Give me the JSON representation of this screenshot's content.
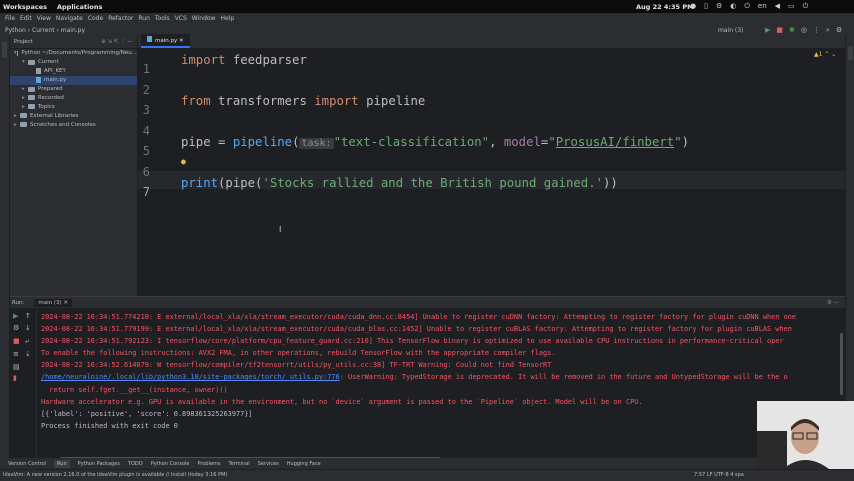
{
  "topbar": {
    "workspaces": "Workspaces",
    "applications": "Applications",
    "clock": "Aug 22  4:35 PM",
    "lang": "en"
  },
  "menu": [
    "File",
    "Edit",
    "View",
    "Navigate",
    "Code",
    "Refactor",
    "Run",
    "Tools",
    "VCS",
    "Window",
    "Help"
  ],
  "nav": {
    "breadcrumb": "Python › Current › main.py",
    "branch": "main (3)"
  },
  "project": {
    "title": "Project",
    "tree": [
      {
        "label": "Python  ~/Documents/Programming/Neu...",
        "indent": 0,
        "type": "folder",
        "open": true
      },
      {
        "label": "Current",
        "indent": 1,
        "type": "folder",
        "open": true
      },
      {
        "label": "API_KEY",
        "indent": 2,
        "type": "file"
      },
      {
        "label": "main.py",
        "indent": 2,
        "type": "pyfile",
        "selected": true
      },
      {
        "label": "Prepared",
        "indent": 1,
        "type": "folder"
      },
      {
        "label": "Recorded",
        "indent": 1,
        "type": "folder"
      },
      {
        "label": "Topics",
        "indent": 1,
        "type": "folder"
      },
      {
        "label": "External Libraries",
        "indent": 0,
        "type": "folder"
      },
      {
        "label": "Scratches and Consoles",
        "indent": 0,
        "type": "folder"
      }
    ]
  },
  "editor": {
    "tab": "main.py",
    "line_numbers": [
      "1",
      "2",
      "3",
      "4",
      "5",
      "6",
      "7"
    ],
    "code": {
      "l1_kw": "import",
      "l1_rest": " feedparser",
      "l3_kw1": "from",
      "l3_mid": " transformers ",
      "l3_kw2": "import",
      "l3_rest": " pipeline",
      "l5_a": "pipe = ",
      "l5_fn": "pipeline",
      "l5_paren": "(",
      "l5_hint": "task:",
      "l5_str1": "\"text-classification\"",
      "l5_comma": ", ",
      "l5_param": "model",
      "l5_eq": "=",
      "l5_q1": "\"",
      "l5_str2": "ProsusAI/finbert",
      "l5_q2": "\"",
      "l5_end": ")",
      "l7_fn": "print",
      "l7_a": "(pipe(",
      "l7_str": "'Stocks rallied and the British pound gained.'",
      "l7_end": "))"
    }
  },
  "run": {
    "label": "Run:",
    "tab": "main (3)",
    "lines": [
      {
        "cls": "err",
        "text": "2024-08-22 16:34:51.774210: E external/local_xla/xla/stream_executor/cuda/cuda_dnn.cc:8454] Unable to register cuDNN factory: Attempting to register factory for plugin cuDNN when one"
      },
      {
        "cls": "err",
        "text": "2024-08-22 16:34:51.779199: E external/local_xla/xla/stream_executor/cuda/cuda_blas.cc:1452] Unable to register cuBLAS factory: Attempting to register factory for plugin cuBLAS when"
      },
      {
        "cls": "err",
        "text": "2024-08-22 16:34:51.792123: I tensorflow/core/platform/cpu_feature_guard.cc:210] This TensorFlow binary is optimized to use available CPU instructions in performance-critical oper"
      },
      {
        "cls": "err",
        "text": "To enable the following instructions: AVX2 FMA, in other operations, rebuild TensorFlow with the appropriate compiler flags."
      },
      {
        "cls": "err",
        "text": "2024-08-22 16:34:52.614879: W tensorflow/compiler/tf2tensorrt/utils/py_utils.cc:38] TF-TRT Warning: Could not find TensorRT"
      },
      {
        "cls": "warn",
        "link": "/home/neuralnine/.local/lib/python3.10/site-packages/torch/_utils.py:776",
        "text": ": UserWarning: TypedStorage is deprecated. It will be removed in the future and UntypedStorage will be the o"
      },
      {
        "cls": "err",
        "text": "  return self.fget.__get__(instance, owner)()"
      },
      {
        "cls": "err",
        "text": "Hardware accelerator e.g. GPU is available in the environment, but no `device` argument is passed to the `Pipeline` object. Model will be on CPU."
      },
      {
        "cls": "plain",
        "text": "[{'label': 'positive', 'score': 0.898361325263977}]"
      },
      {
        "cls": "plain",
        "text": ""
      },
      {
        "cls": "plain",
        "text": "Process finished with exit code 0"
      }
    ]
  },
  "toolwindows": [
    "Version Control",
    "Run",
    "Python Packages",
    "TODO",
    "Python Console",
    "Problems",
    "Terminal",
    "Services",
    "Hugging Face"
  ],
  "status": {
    "message": "IdeaVim: A new version 2.16.0 of the IdeaVim plugin is available // Install (today 3:16 PM)",
    "info": "7:57   LF   UTF-8   4 spa"
  }
}
